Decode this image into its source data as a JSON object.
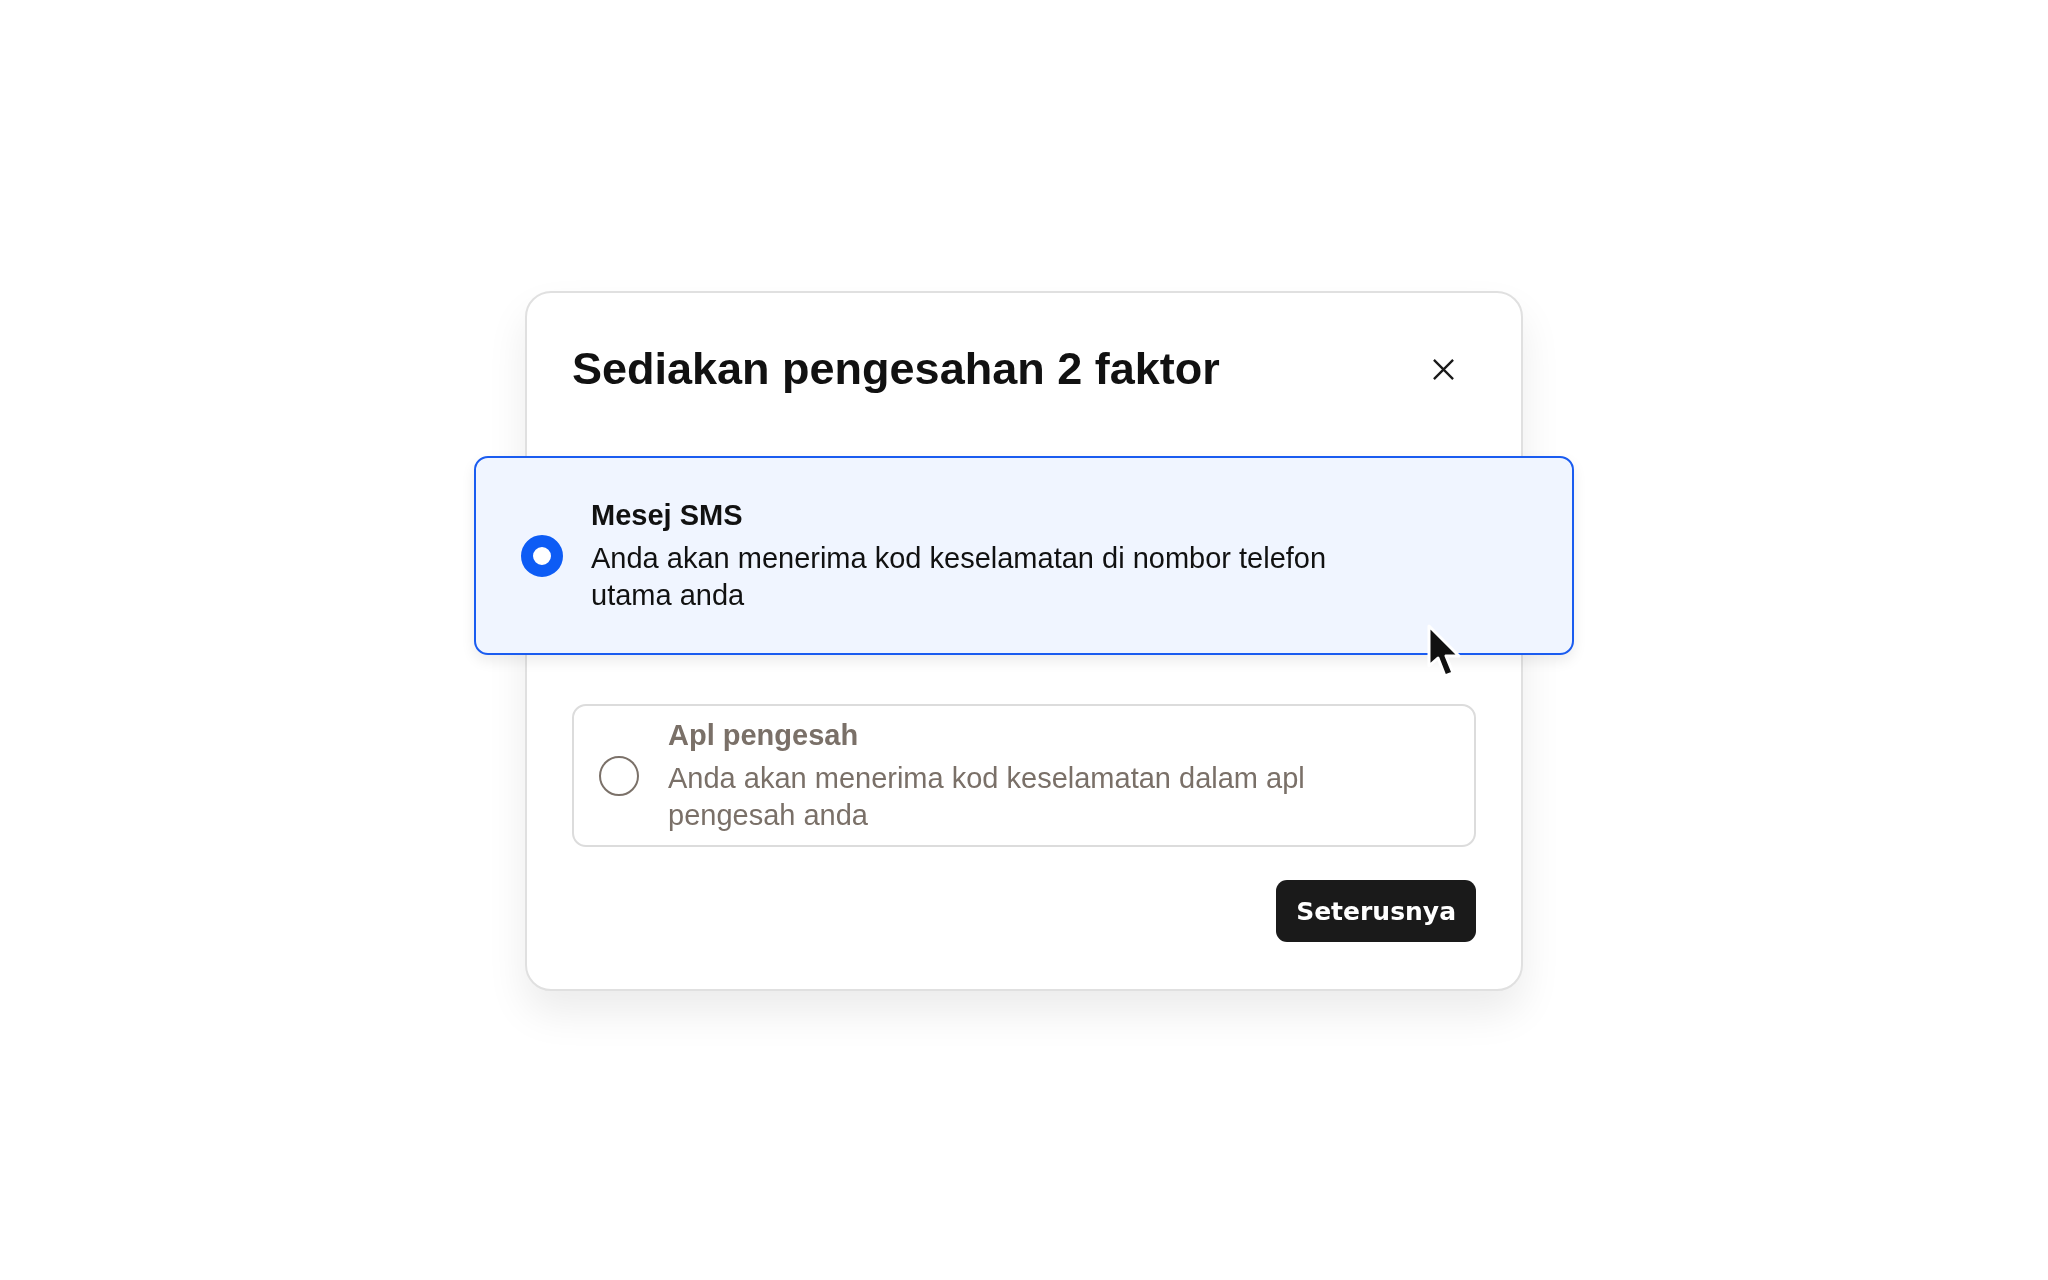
{
  "dialog": {
    "title": "Sediakan pengesahan 2 faktor",
    "options": [
      {
        "title": "Mesej SMS",
        "description": "Anda akan menerima kod keselamatan di nombor telefon utama anda",
        "selected": true
      },
      {
        "title": "Apl pengesah",
        "description": "Anda akan menerima kod keselamatan dalam apl pengesah anda",
        "selected": false
      }
    ],
    "buttons": [
      {
        "label": "Seterusnya"
      }
    ]
  }
}
